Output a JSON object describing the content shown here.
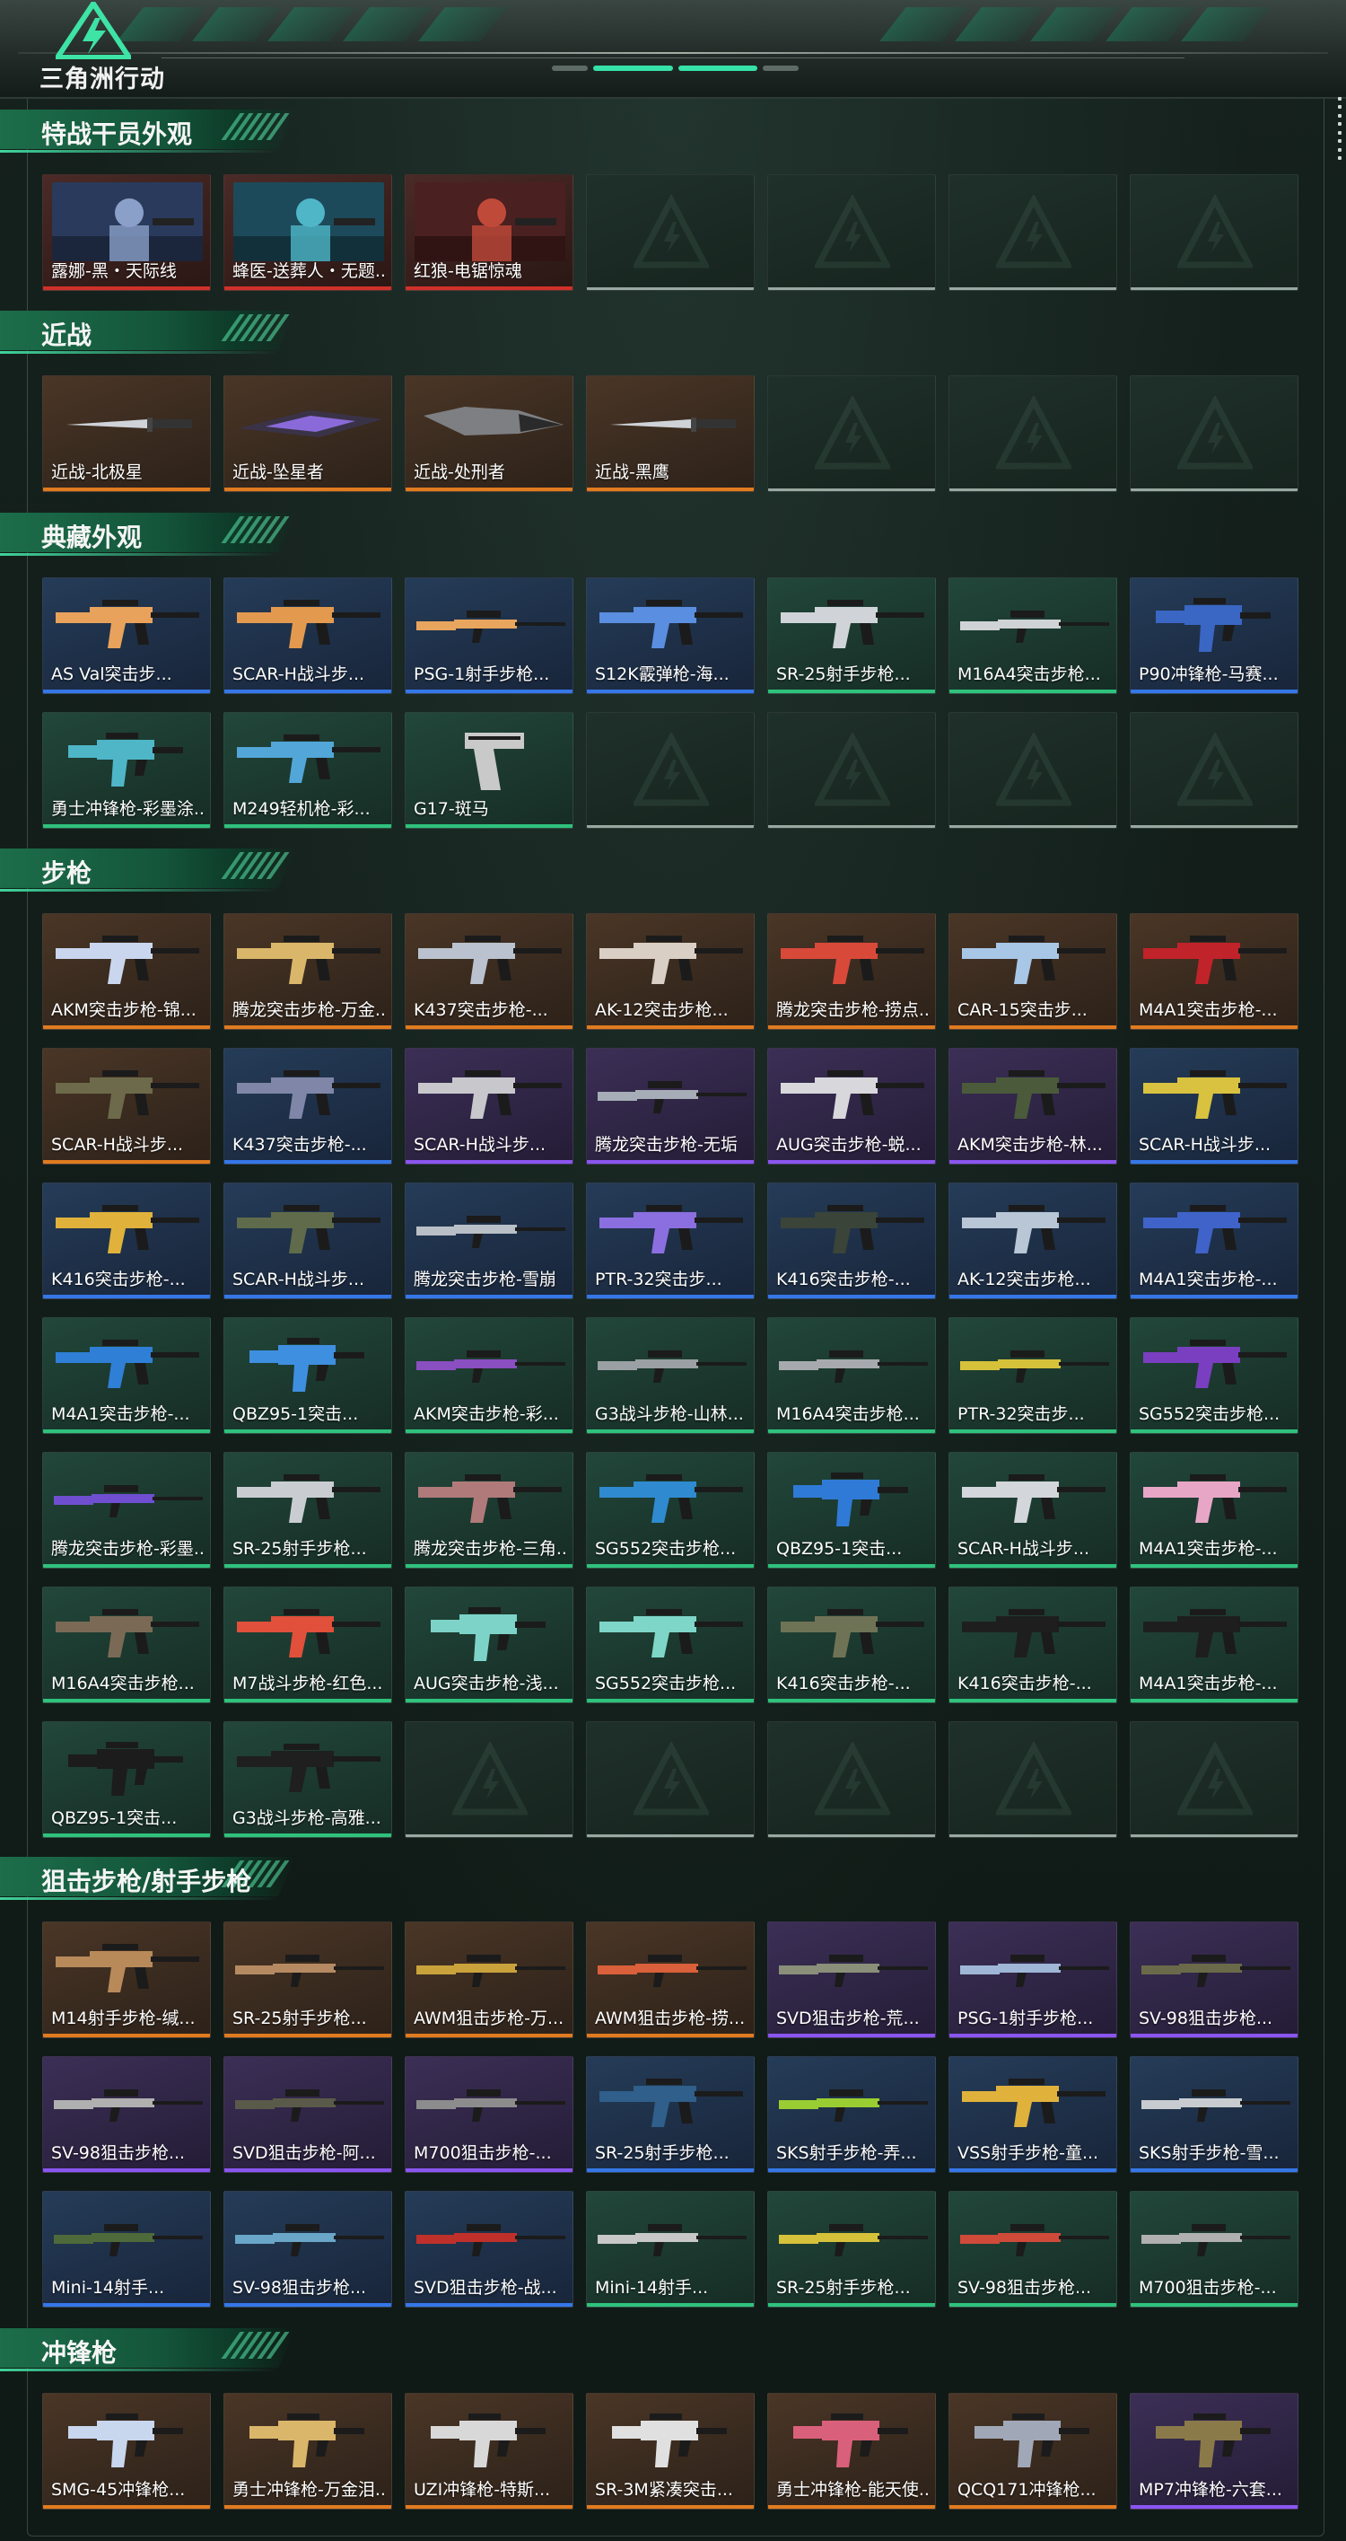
{
  "header": {
    "logo_text": "三角洲行动",
    "logo_icon": "delta-triangle-icon",
    "accent_color": "#36e2a8"
  },
  "sections": [
    {
      "title": "特战干员外观",
      "items": [
        {
          "label": "露娜-黑・天际线",
          "rarity": "red",
          "kind": "operator"
        },
        {
          "label": "蜂医-送葬人・无题...",
          "rarity": "red",
          "kind": "operator"
        },
        {
          "label": "红狼-电锯惊魂",
          "rarity": "red",
          "kind": "operator"
        }
      ],
      "empty_slots": 4
    },
    {
      "title": "近战",
      "items": [
        {
          "label": "近战-北极星",
          "rarity": "orange",
          "kind": "knife"
        },
        {
          "label": "近战-坠星者",
          "rarity": "orange",
          "kind": "blade"
        },
        {
          "label": "近战-处刑者",
          "rarity": "orange",
          "kind": "axe"
        },
        {
          "label": "近战-黑鹰",
          "rarity": "orange",
          "kind": "knife"
        }
      ],
      "empty_slots": 3
    },
    {
      "title": "典藏外观",
      "items": [
        {
          "label": "AS Val突击步...",
          "rarity": "blue",
          "kind": "rifle",
          "color": "#e8a25c"
        },
        {
          "label": "SCAR-H战斗步...",
          "rarity": "blue",
          "kind": "rifle",
          "color": "#e39a4f"
        },
        {
          "label": "PSG-1射手步枪...",
          "rarity": "blue",
          "kind": "sniper",
          "color": "#e8a55e"
        },
        {
          "label": "S12K霰弹枪-海...",
          "rarity": "blue",
          "kind": "rifle",
          "color": "#5a8ee0"
        },
        {
          "label": "SR-25射手步枪...",
          "rarity": "green",
          "kind": "rifle",
          "color": "#d0d4d8"
        },
        {
          "label": "M16A4突击步枪...",
          "rarity": "green",
          "kind": "sniper",
          "color": "#cfd3d6"
        },
        {
          "label": "P90冲锋枪-马赛...",
          "rarity": "blue",
          "kind": "smg",
          "color": "#3a66c4"
        },
        {
          "label": "勇士冲锋枪-彩墨涂...",
          "rarity": "green",
          "kind": "smg",
          "color": "#4fb6c8"
        },
        {
          "label": "M249轻机枪-彩...",
          "rarity": "green",
          "kind": "rifle",
          "color": "#53a6d8"
        },
        {
          "label": "G17-斑马",
          "rarity": "green",
          "kind": "pistol",
          "color": "#c9c9c9"
        }
      ],
      "empty_slots": 4
    },
    {
      "title": "步枪",
      "items": [
        {
          "label": "AKM突击步枪-锦...",
          "rarity": "orange",
          "kind": "rifle",
          "color": "#c9d6ee"
        },
        {
          "label": "腾龙突击步枪-万金...",
          "rarity": "orange",
          "kind": "rifle",
          "color": "#d9b66a"
        },
        {
          "label": "K437突击步枪-...",
          "rarity": "orange",
          "kind": "rifle",
          "color": "#b9c2ce"
        },
        {
          "label": "AK-12突击步枪...",
          "rarity": "orange",
          "kind": "rifle",
          "color": "#d9cfc4"
        },
        {
          "label": "腾龙突击步枪-捞点...",
          "rarity": "orange",
          "kind": "rifle",
          "color": "#d9493a"
        },
        {
          "label": "CAR-15突击步...",
          "rarity": "orange",
          "kind": "rifle",
          "color": "#a8c6e6"
        },
        {
          "label": "M4A1突击步枪-...",
          "rarity": "orange",
          "kind": "rifle",
          "color": "#c0232a"
        },
        {
          "label": "SCAR-H战斗步...",
          "rarity": "orange",
          "kind": "rifle",
          "color": "#6c6a4a"
        },
        {
          "label": "K437突击步枪-...",
          "rarity": "blue",
          "kind": "rifle",
          "color": "#7f86a8"
        },
        {
          "label": "SCAR-H战斗步...",
          "rarity": "purple",
          "kind": "rifle",
          "color": "#c8c8cc"
        },
        {
          "label": "腾龙突击步枪-无垢",
          "rarity": "purple",
          "kind": "sniper",
          "color": "#a6adb6"
        },
        {
          "label": "AUG突击步枪-蜕...",
          "rarity": "purple",
          "kind": "rifle",
          "color": "#d8d8dc"
        },
        {
          "label": "AKM突击步枪-林...",
          "rarity": "purple",
          "kind": "rifle",
          "color": "#4a5a3a"
        },
        {
          "label": "SCAR-H战斗步...",
          "rarity": "blue",
          "kind": "rifle",
          "color": "#d8c240"
        },
        {
          "label": "K416突击步枪-...",
          "rarity": "blue",
          "kind": "rifle",
          "color": "#e0b23c"
        },
        {
          "label": "SCAR-H战斗步...",
          "rarity": "blue",
          "kind": "rifle",
          "color": "#5f6b4a"
        },
        {
          "label": "腾龙突击步枪-雪崩",
          "rarity": "blue",
          "kind": "sniper",
          "color": "#b8bfc6"
        },
        {
          "label": "PTR-32突击步...",
          "rarity": "blue",
          "kind": "rifle",
          "color": "#8b6fe0"
        },
        {
          "label": "K416突击步枪-...",
          "rarity": "blue",
          "kind": "rifle",
          "color": "#3a4438"
        },
        {
          "label": "AK-12突击步枪...",
          "rarity": "blue",
          "kind": "rifle",
          "color": "#b9c6d6"
        },
        {
          "label": "M4A1突击步枪-...",
          "rarity": "blue",
          "kind": "rifle",
          "color": "#3f63c8"
        },
        {
          "label": "M4A1突击步枪-...",
          "rarity": "green",
          "kind": "rifle",
          "color": "#2f7fd6"
        },
        {
          "label": "QBZ95-1突击...",
          "rarity": "green",
          "kind": "smg",
          "color": "#3f8fe0"
        },
        {
          "label": "AKM突击步枪-彩...",
          "rarity": "green",
          "kind": "sniper",
          "color": "#8a4fc0"
        },
        {
          "label": "G3战斗步枪-山林...",
          "rarity": "green",
          "kind": "sniper",
          "color": "#9aa0a4"
        },
        {
          "label": "M16A4突击步枪...",
          "rarity": "green",
          "kind": "sniper",
          "color": "#a6aaae"
        },
        {
          "label": "PTR-32突击步...",
          "rarity": "green",
          "kind": "sniper",
          "color": "#d6c23a"
        },
        {
          "label": "SG552突击步枪...",
          "rarity": "green",
          "kind": "rifle",
          "color": "#7a3fc0"
        },
        {
          "label": "腾龙突击步枪-彩墨...",
          "rarity": "green",
          "kind": "sniper",
          "color": "#6f4fd0"
        },
        {
          "label": "SR-25射手步枪...",
          "rarity": "green",
          "kind": "rifle",
          "color": "#c9cdd2"
        },
        {
          "label": "腾龙突击步枪-三角...",
          "rarity": "green",
          "kind": "rifle",
          "color": "#b07a7a"
        },
        {
          "label": "SG552突击步枪...",
          "rarity": "green",
          "kind": "rifle",
          "color": "#2f8ad0"
        },
        {
          "label": "QBZ95-1突击...",
          "rarity": "green",
          "kind": "smg",
          "color": "#2f7ad6"
        },
        {
          "label": "SCAR-H战斗步...",
          "rarity": "green",
          "kind": "rifle",
          "color": "#d3d6da"
        },
        {
          "label": "M4A1突击步枪-...",
          "rarity": "green",
          "kind": "rifle",
          "color": "#e8a6c6"
        },
        {
          "label": "M16A4突击步枪...",
          "rarity": "green",
          "kind": "rifle",
          "color": "#7a6a55"
        },
        {
          "label": "M7战斗步枪-红色...",
          "rarity": "green",
          "kind": "rifle",
          "color": "#e0503a"
        },
        {
          "label": "AUG突击步枪-浅...",
          "rarity": "green",
          "kind": "smg",
          "color": "#7ed3c8"
        },
        {
          "label": "SG552突击步枪...",
          "rarity": "green",
          "kind": "rifle",
          "color": "#7ed6c8"
        },
        {
          "label": "K416突击步枪-...",
          "rarity": "green",
          "kind": "rifle",
          "color": "#6f7355"
        },
        {
          "label": "K416突击步枪-...",
          "rarity": "green",
          "kind": "rifle",
          "color": "#1e1e1e"
        },
        {
          "label": "M4A1突击步枪-...",
          "rarity": "green",
          "kind": "rifle",
          "color": "#1e1e1e"
        },
        {
          "label": "QBZ95-1突击...",
          "rarity": "green",
          "kind": "smg",
          "color": "#1c1c1c"
        },
        {
          "label": "G3战斗步枪-高雅...",
          "rarity": "green",
          "kind": "rifle",
          "color": "#1f1f1f"
        }
      ],
      "empty_slots": 5
    },
    {
      "title": "狙击步枪/射手步枪",
      "items": [
        {
          "label": "M14射手步枪-缄...",
          "rarity": "orange",
          "kind": "rifle",
          "color": "#b88a5a"
        },
        {
          "label": "SR-25射手步枪...",
          "rarity": "orange",
          "kind": "sniper",
          "color": "#b58a62"
        },
        {
          "label": "AWM狙击步枪-万...",
          "rarity": "orange",
          "kind": "sniper",
          "color": "#c9a23c"
        },
        {
          "label": "AWM狙击步枪-捞...",
          "rarity": "orange",
          "kind": "sniper",
          "color": "#d9603a"
        },
        {
          "label": "SVD狙击步枪-荒...",
          "rarity": "purple",
          "kind": "sniper",
          "color": "#8a8f7a"
        },
        {
          "label": "PSG-1射手步枪...",
          "rarity": "purple",
          "kind": "sniper",
          "color": "#9fb6d6"
        },
        {
          "label": "SV-98狙击步枪...",
          "rarity": "purple",
          "kind": "sniper",
          "color": "#6a6a4a"
        },
        {
          "label": "SV-98狙击步枪...",
          "rarity": "purple",
          "kind": "sniper",
          "color": "#b0b0b0"
        },
        {
          "label": "SVD狙击步枪-阿...",
          "rarity": "purple",
          "kind": "sniper",
          "color": "#5a5a4a"
        },
        {
          "label": "M700狙击步枪-...",
          "rarity": "purple",
          "kind": "sniper",
          "color": "#8c8c8c"
        },
        {
          "label": "SR-25射手步枪...",
          "rarity": "blue",
          "kind": "rifle",
          "color": "#2f5f8a"
        },
        {
          "label": "SKS射手步枪-弄...",
          "rarity": "blue",
          "kind": "sniper",
          "color": "#9acd32"
        },
        {
          "label": "VSS射手步枪-童...",
          "rarity": "blue",
          "kind": "rifle",
          "color": "#e0b23c"
        },
        {
          "label": "SKS射手步枪-雪...",
          "rarity": "blue",
          "kind": "sniper",
          "color": "#c8ccd0"
        },
        {
          "label": "Mini-14射手...",
          "rarity": "blue",
          "kind": "sniper",
          "color": "#4f6a3a"
        },
        {
          "label": "SV-98狙击步枪...",
          "rarity": "blue",
          "kind": "sniper",
          "color": "#6aa6c8"
        },
        {
          "label": "SVD狙击步枪-战...",
          "rarity": "blue",
          "kind": "sniper",
          "color": "#c0302a"
        },
        {
          "label": "Mini-14射手...",
          "rarity": "green",
          "kind": "sniper",
          "color": "#c8c8c8"
        },
        {
          "label": "SR-25射手步枪...",
          "rarity": "green",
          "kind": "sniper",
          "color": "#d6c23a"
        },
        {
          "label": "SV-98狙击步枪...",
          "rarity": "green",
          "kind": "sniper",
          "color": "#d04a3a"
        },
        {
          "label": "M700狙击步枪-...",
          "rarity": "green",
          "kind": "sniper",
          "color": "#b0b0b0"
        }
      ],
      "empty_slots": 0
    },
    {
      "title": "冲锋枪",
      "items": [
        {
          "label": "SMG-45冲锋枪...",
          "rarity": "orange",
          "kind": "smg",
          "color": "#c8d6ee"
        },
        {
          "label": "勇士冲锋枪-万金泪...",
          "rarity": "orange",
          "kind": "smg",
          "color": "#d9b66a"
        },
        {
          "label": "UZI冲锋枪-特斯...",
          "rarity": "orange",
          "kind": "smg",
          "color": "#d8d8d8"
        },
        {
          "label": "SR-3M紧凑突击...",
          "rarity": "orange",
          "kind": "smg",
          "color": "#e0e0e0"
        },
        {
          "label": "勇士冲锋枪-能天使...",
          "rarity": "orange",
          "kind": "smg",
          "color": "#d9607a"
        },
        {
          "label": "QCQ171冲锋枪...",
          "rarity": "orange",
          "kind": "smg",
          "color": "#a0a8b8"
        },
        {
          "label": "MP7冲锋枪-六套...",
          "rarity": "purple",
          "kind": "smg",
          "color": "#8a7a4a"
        }
      ],
      "empty_slots": 0
    }
  ]
}
